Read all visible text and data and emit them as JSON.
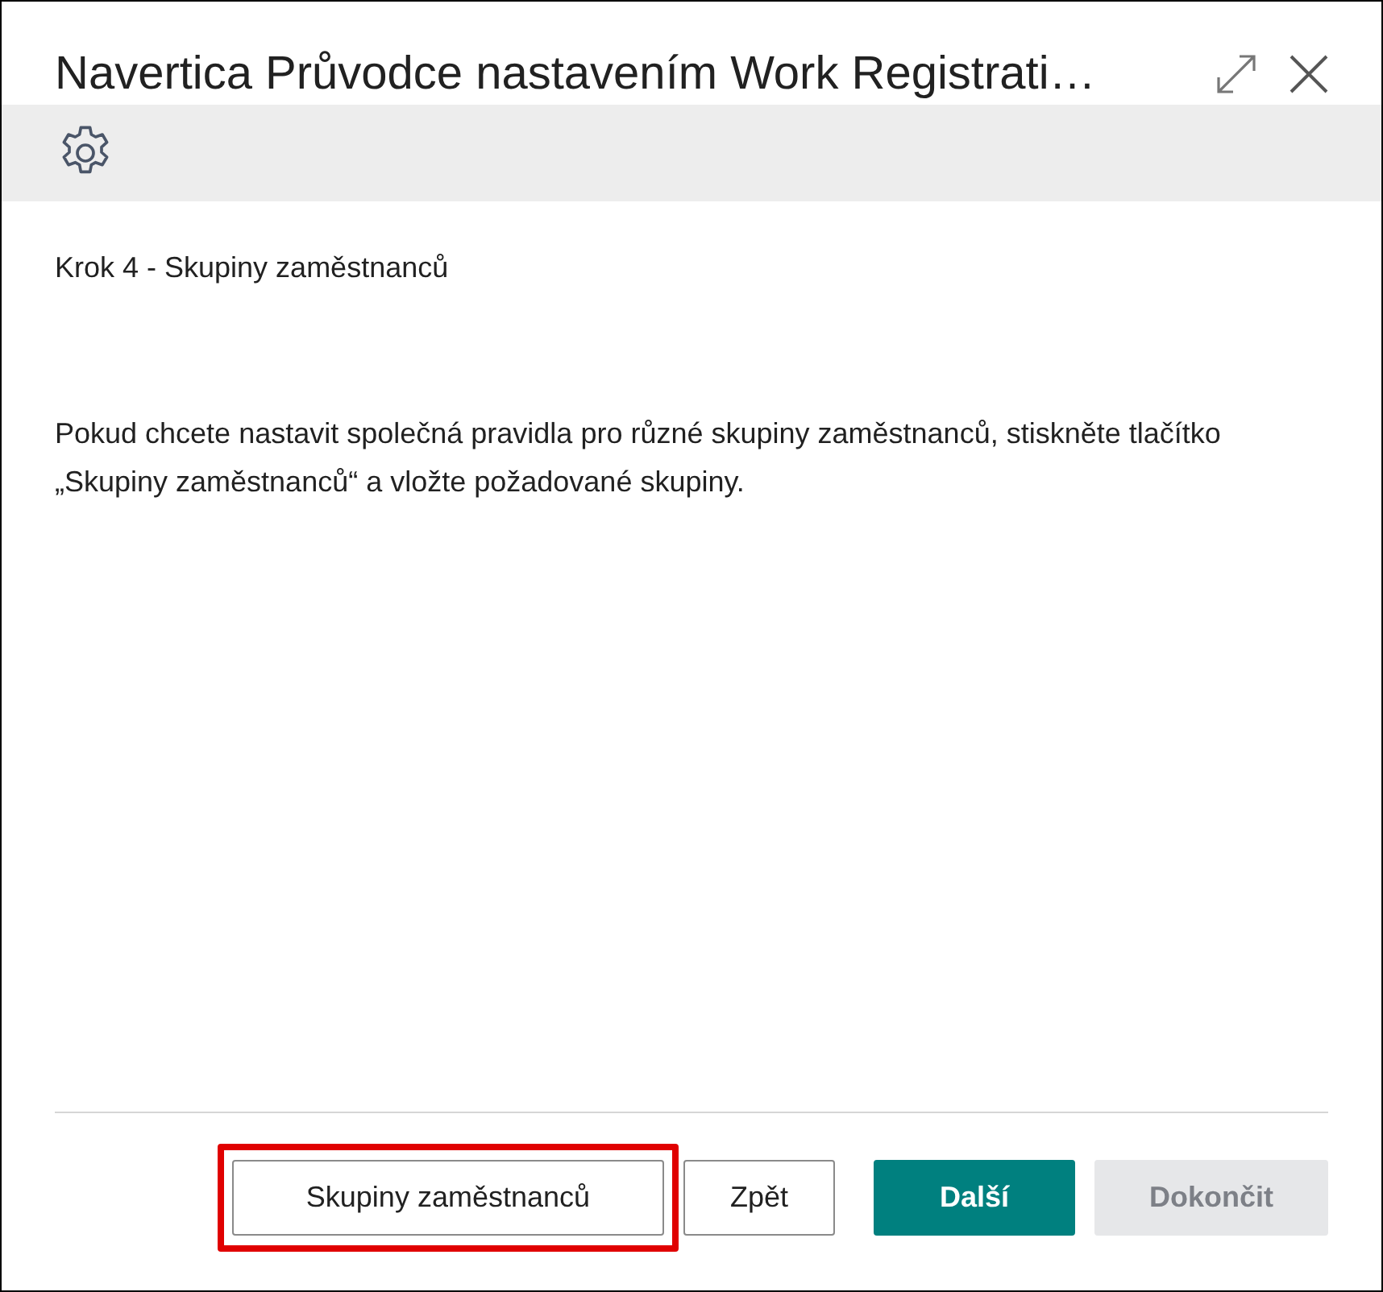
{
  "window": {
    "title": "Navertica Průvodce nastavením Work Registrati…"
  },
  "toolbar": {
    "items": [
      {
        "kind": "settings"
      }
    ]
  },
  "step": "Krok 4 - Skupiny zaměstnanců",
  "description": "Pokud chcete nastavit společná pravidla pro různé skupiny zaměstnanců, stiskněte tlačítko „Skupiny zaměstnanců“ a vložte požadované skupiny.",
  "buttons": [
    {
      "label": "Skupiny zaměstnanců",
      "kind": "secondary",
      "disabled": false,
      "highlighted": true
    },
    {
      "label": "Zpět",
      "kind": "secondary",
      "disabled": false,
      "highlighted": false
    },
    {
      "label": "Další",
      "kind": "primary",
      "disabled": false,
      "highlighted": false
    },
    {
      "label": "Dokončit",
      "kind": "primary",
      "disabled": true,
      "highlighted": false
    }
  ]
}
